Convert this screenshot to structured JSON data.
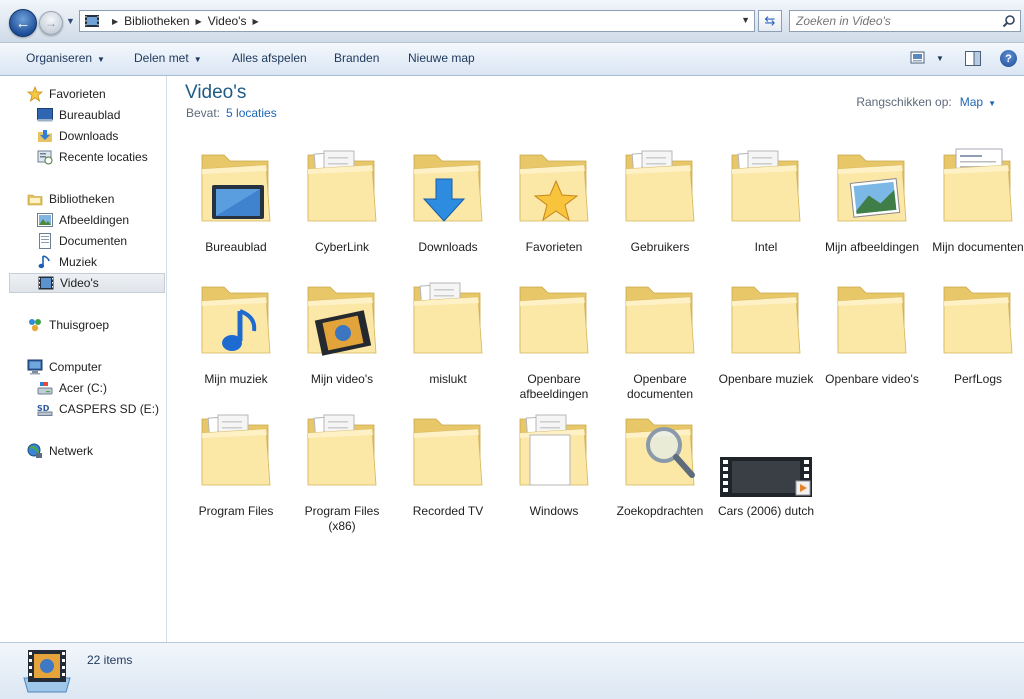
{
  "address": {
    "crumbs": [
      "Bibliotheken",
      "Video's"
    ],
    "search_placeholder": "Zoeken in Video's"
  },
  "toolbar": {
    "organize": "Organiseren",
    "share": "Delen met",
    "play_all": "Alles afspelen",
    "burn": "Branden",
    "new_folder": "Nieuwe map",
    "help": "?"
  },
  "nav": {
    "favorites": "Favorieten",
    "desktop": "Bureaublad",
    "downloads": "Downloads",
    "recent": "Recente locaties",
    "libraries": "Bibliotheken",
    "pictures": "Afbeeldingen",
    "documents": "Documenten",
    "music": "Muziek",
    "videos": "Video's",
    "homegroup": "Thuisgroep",
    "computer": "Computer",
    "drive_c": "Acer (C:)",
    "drive_e": "CASPERS SD (E:)",
    "network": "Netwerk"
  },
  "content": {
    "title": "Video's",
    "includes_label": "Bevat:",
    "includes_link": "5 locaties",
    "arrange_label": "Rangschikken op:",
    "arrange_value": "Map",
    "items": [
      {
        "label": "Bureaublad",
        "overlay": "monitor"
      },
      {
        "label": "CyberLink",
        "overlay": "papers"
      },
      {
        "label": "Downloads",
        "overlay": "download-arrow"
      },
      {
        "label": "Favorieten",
        "overlay": "star"
      },
      {
        "label": "Gebruikers",
        "overlay": "papers"
      },
      {
        "label": "Intel",
        "overlay": "papers"
      },
      {
        "label": "Mijn afbeeldingen",
        "overlay": "photo"
      },
      {
        "label": "Mijn documenten",
        "overlay": "document"
      },
      {
        "label": "Mijn muziek",
        "overlay": "music-note"
      },
      {
        "label": "Mijn video's",
        "overlay": "filmstrip"
      },
      {
        "label": "mislukt",
        "overlay": "papers"
      },
      {
        "label": "Openbare afbeeldingen",
        "overlay": "none"
      },
      {
        "label": "Openbare documenten",
        "overlay": "none"
      },
      {
        "label": "Openbare muziek",
        "overlay": "none"
      },
      {
        "label": "Openbare video's",
        "overlay": "none"
      },
      {
        "label": "PerfLogs",
        "overlay": "none"
      },
      {
        "label": "Program Files",
        "overlay": "papers"
      },
      {
        "label": "Program Files (x86)",
        "overlay": "papers"
      },
      {
        "label": "Recorded TV",
        "overlay": "none"
      },
      {
        "label": "Windows",
        "overlay": "papers-white"
      },
      {
        "label": "Zoekopdrachten",
        "overlay": "magnifier"
      },
      {
        "label": "Cars (2006) dutch",
        "overlay": "video-file"
      }
    ]
  },
  "status": {
    "count": "22 items"
  },
  "colors": {
    "folder_light": "#fbe7a6",
    "folder_dark": "#e7c767",
    "title_blue": "#1e5b86",
    "link_blue": "#1f65b5"
  }
}
